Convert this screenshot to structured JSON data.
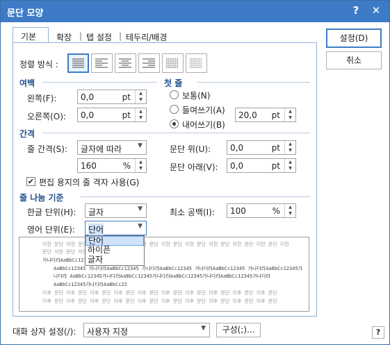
{
  "window": {
    "title": "문단 모양",
    "help": "?",
    "close": "✕"
  },
  "tabs": [
    "기본",
    "확장",
    "탭 설정",
    "테두리/배경"
  ],
  "tab_seps": [
    "|",
    "|",
    "|"
  ],
  "buttons": {
    "ok": "설정(D)",
    "cancel": "취소"
  },
  "align": {
    "label": "정렬 방식 :"
  },
  "margin": {
    "section": "여백",
    "left_label": "왼쪽(F):",
    "left_value": "0,0",
    "left_unit": "pt",
    "right_label": "오른쪽(O):",
    "right_value": "0,0",
    "right_unit": "pt"
  },
  "first": {
    "section": "첫 줄",
    "normal": "보통(N)",
    "indent": "들여쓰기(A)",
    "outdent": "내어쓰기(B)",
    "value": "20,0",
    "unit": "pt"
  },
  "spacing": {
    "section": "간격",
    "line_label": "줄 간격(S):",
    "line_type": "글자에 따라",
    "line_value": "160",
    "line_unit": "%",
    "above_label": "문단 위(U):",
    "above_value": "0,0",
    "above_unit": "pt",
    "below_label": "문단 아래(V):",
    "below_value": "0,0",
    "below_unit": "pt",
    "grid_check": "편집 용지의 줄 격자 사용(G)"
  },
  "wrap": {
    "section": "줄 나눔 기준",
    "korean_label": "한글 단위(H):",
    "korean_value": "글자",
    "min_label": "최소 공백(I):",
    "min_value": "100",
    "min_unit": "%",
    "english_label": "영어 단위(E):",
    "english_value": "단어",
    "options": [
      "단어",
      "하이픈",
      "글자"
    ]
  },
  "preview": {
    "prev_line": "이전 문단 이전 문단 이전 문단 이전 문단 이전 문단 이전 문단 이전 문단 이전 문단 이전 문단 이전 문단 이전",
    "prev_line2": "문단 이전 문단 이전 문단",
    "t1": "가나다라AaBbCc12345",
    "t2": "AaBbCc12345 가나다라AaBbCc12345 가나다라AaBbCc12345 가나다라AaBbCc12345 가나다라AaBbCc12345가",
    "t3": "나다라 AaBbCc12345가나다라AaBbCc12345가나다라AaBbCc12345가나다라AaBbCc12345가나다라",
    "t4": "AaBbCc12345가나다라AaBbCc22",
    "next_line": "이후 문단 이후 문단 이후 문단 이후 문단 이후 문단 이후 문단 이후 문단 이후 문단 이후 문단 이후 문단",
    "next_line2": "이후 문단 이후 문단 이후 문단 이후 문단 이후 문단 이후 문단 이후 문단 이후 문단 이후 문단 이후 문단"
  },
  "footer": {
    "label": "대화 상자 설정(/):",
    "value": "사용자 지정",
    "config": "구성(;)...",
    "help": "?"
  }
}
